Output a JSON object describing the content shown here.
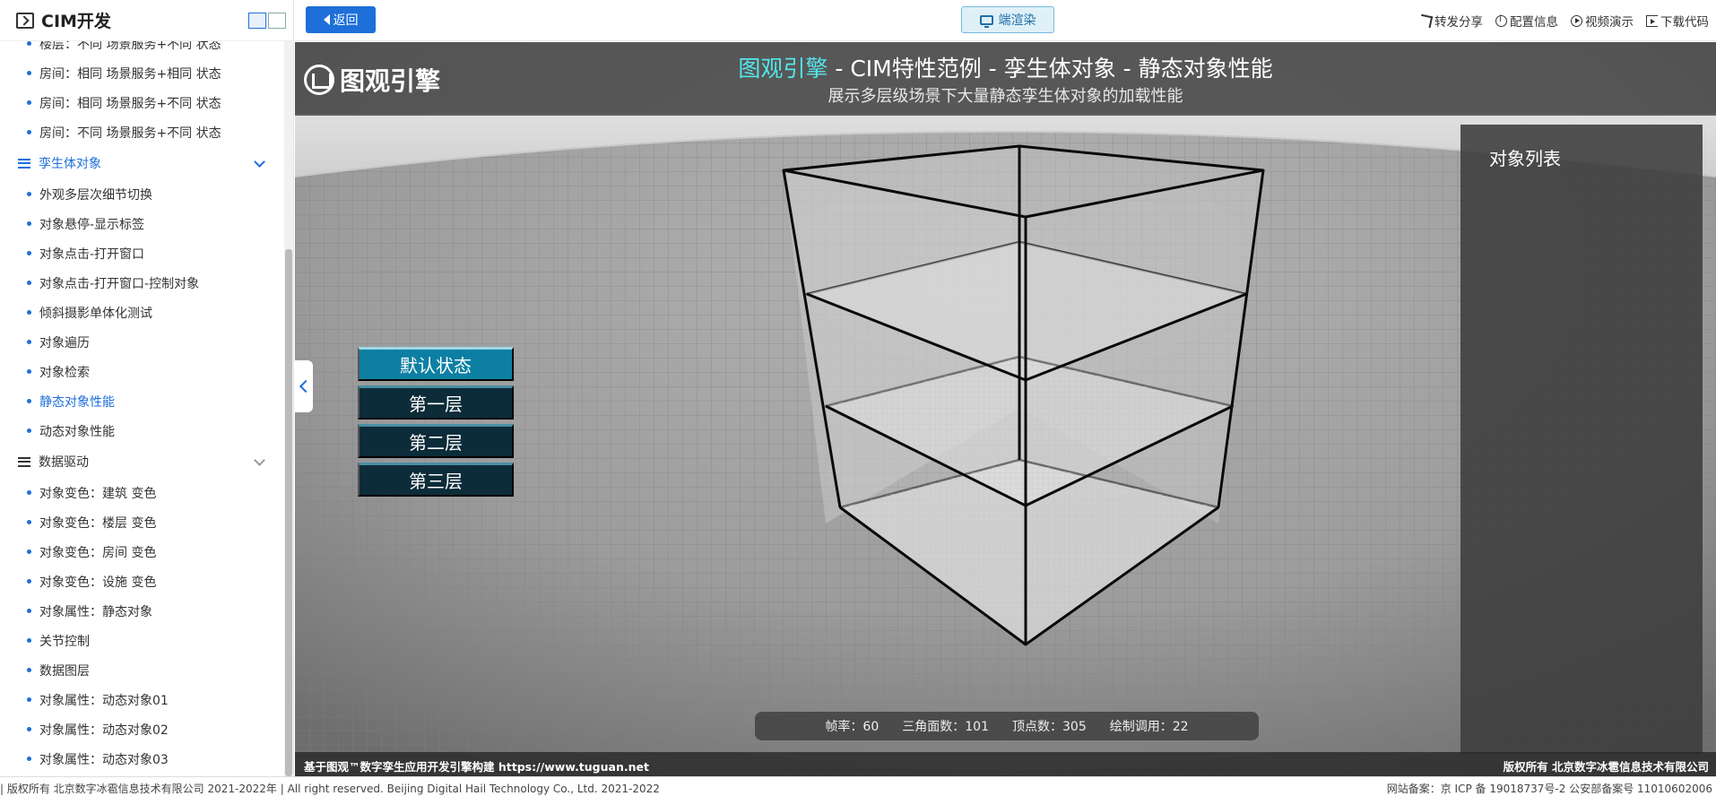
{
  "sidebar": {
    "title": "CIM开发",
    "items_top": [
      "楼层：不同 场景服务+不同 状态",
      "房间：相同 场景服务+相同 状态",
      "房间：相同 场景服务+不同 状态",
      "房间：不同 场景服务+不同 状态"
    ],
    "group_twin": "孪生体对象",
    "items_twin": [
      "外观多层次细节切换",
      "对象悬停-显示标签",
      "对象点击-打开窗口",
      "对象点击-打开窗口-控制对象",
      "倾斜摄影单体化测试",
      "对象遍历",
      "对象检索",
      "静态对象性能",
      "动态对象性能"
    ],
    "group_data": "数据驱动",
    "items_data": [
      "对象变色：建筑 变色",
      "对象变色：楼层 变色",
      "对象变色：房间 变色",
      "对象变色：设施 变色",
      "对象属性：静态对象",
      "关节控制",
      "数据图层",
      "对象属性：动态对象01",
      "对象属性：动态对象02",
      "对象属性：动态对象03"
    ]
  },
  "topbar": {
    "back_label": "返回",
    "render_label": "端渲染",
    "actions": [
      "转发分享",
      "配置信息",
      "视频演示",
      "下载代码"
    ]
  },
  "viewport": {
    "brand": "图观引擎",
    "title_accent": "图观引擎",
    "title_rest": " - CIM特性范例 - 孪生体对象 - 静态对象性能",
    "subtitle": "展示多层级场景下大量静态孪生体对象的加载性能",
    "layer_buttons": [
      "默认状态",
      "第一层",
      "第二层",
      "第三层"
    ],
    "object_panel_title": "对象列表",
    "stats": {
      "fps": "帧率：60",
      "triangles": "三角面数：101",
      "vertices": "顶点数：305",
      "draw_calls": "绘制调用：22"
    },
    "footer_left": "基于图观™数字孪生应用开发引擎构建 https://www.tuguan.net",
    "footer_right": "版权所有 北京数字冰雹信息技术有限公司"
  },
  "page_footer": {
    "left": "| 版权所有 北京数字冰雹信息技术有限公司 2021-2022年 | All right reserved. Beijing Digital Hail Technology Co., Ltd. 2021-2022",
    "right": "网站备案：京 ICP 备 19018737号-2 公安部备案号 11010602006"
  },
  "colors": {
    "accent": "#1e6fd9",
    "title_accent": "#53e6ea",
    "layer_btn": "#0c2c39",
    "layer_btn_active": "#0d7fa3"
  }
}
